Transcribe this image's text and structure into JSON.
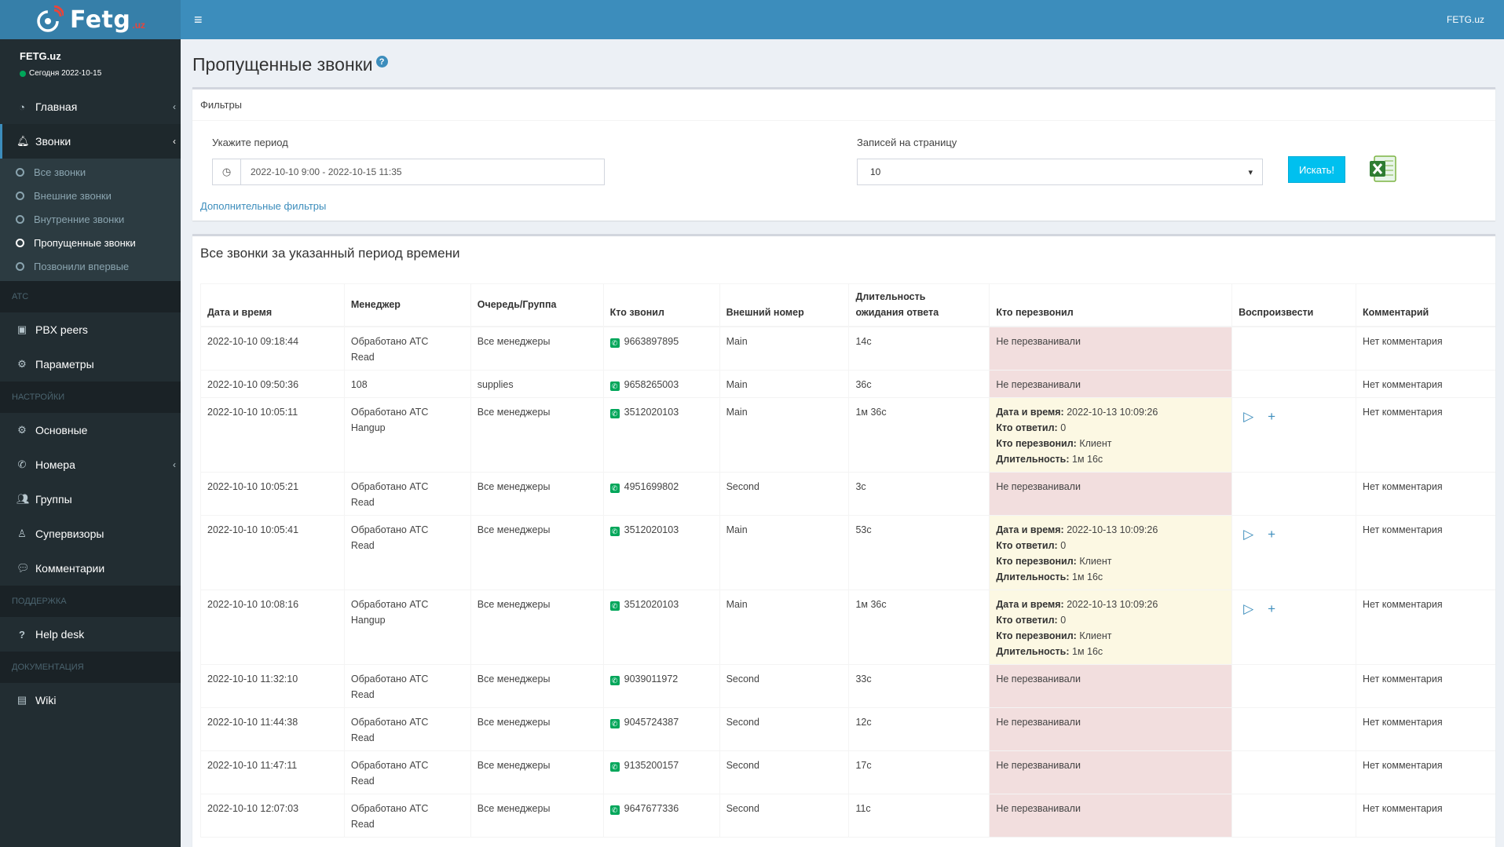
{
  "brand": {
    "name": "Fetg",
    "tld": ".uz"
  },
  "user": {
    "name": "FETG.uz",
    "status": "Сегодня 2022-10-15"
  },
  "sidebar": {
    "main": {
      "label": "Главная"
    },
    "calls": {
      "label": "Звонки"
    },
    "calls_sub": [
      {
        "label": "Все звонки"
      },
      {
        "label": "Внешние звонки"
      },
      {
        "label": "Внутренние звонки"
      },
      {
        "label": "Пропущенные звонки"
      },
      {
        "label": "Позвонили впервые"
      }
    ],
    "header_atc": "АТС",
    "pbx": {
      "label": "PBX peers"
    },
    "params": {
      "label": "Параметры"
    },
    "header_settings": "НАСТРОЙКИ",
    "basic": {
      "label": "Основные"
    },
    "numbers": {
      "label": "Номера"
    },
    "groups": {
      "label": "Группы"
    },
    "supervisors": {
      "label": "Супервизоры"
    },
    "comments": {
      "label": "Комментарии"
    },
    "header_support": "ПОДДЕРЖКА",
    "helpdesk": {
      "label": "Help desk"
    },
    "header_docs": "ДОКУМЕНТАЦИЯ",
    "wiki": {
      "label": "Wiki"
    }
  },
  "topbar": {
    "right": "FETG.uz"
  },
  "page": {
    "title": "Пропущенные звонки"
  },
  "filters": {
    "title": "Фильтры",
    "period_label": "Укажите период",
    "period_value": "2022-10-10 9:00 - 2022-10-15 11:35",
    "per_page_label": "Записей на страницу",
    "per_page_value": "10",
    "search_label": "Искать!",
    "more_filters": "Дополнительные фильтры"
  },
  "table": {
    "title": "Все звонки за указанный период времени",
    "columns": {
      "datetime": "Дата и время",
      "manager": "Менеджер",
      "queue": "Очередь/Группа",
      "caller": "Кто звонил",
      "external": "Внешний номер",
      "wait1": "Длительность",
      "wait2": "ожидания ответа",
      "callback": "Кто перезвонил",
      "play": "Воспроизвести",
      "comment": "Комментарий"
    },
    "cb_labels": {
      "datetime": "Дата и время:",
      "answered": "Кто ответил:",
      "called_back": "Кто перезвонил:",
      "duration": "Длительность:"
    },
    "no_callback": "Не перезванивали",
    "no_comment": "Нет комментария",
    "rows": [
      {
        "datetime": "2022-10-10 09:18:44",
        "manager1": "Обработано АТС",
        "manager2": "Read",
        "queue": "Все менеджеры",
        "caller": "9663897895",
        "external": "Main",
        "wait": "14с"
      },
      {
        "datetime": "2022-10-10 09:50:36",
        "manager1": "108",
        "manager2": "",
        "queue": "supplies",
        "caller": "9658265003",
        "external": "Main",
        "wait": "36с"
      },
      {
        "datetime": "2022-10-10 10:05:11",
        "manager1": "Обработано АТС",
        "manager2": "Hangup",
        "queue": "Все менеджеры",
        "caller": "3512020103",
        "external": "Main",
        "wait": "1м 36с",
        "cb": {
          "datetime": "2022-10-13 10:09:26",
          "answered": "0",
          "called_back": "Клиент",
          "duration": "1м 16с"
        }
      },
      {
        "datetime": "2022-10-10 10:05:21",
        "manager1": "Обработано АТС",
        "manager2": "Read",
        "queue": "Все менеджеры",
        "caller": "4951699802",
        "external": "Second",
        "wait": "3с"
      },
      {
        "datetime": "2022-10-10 10:05:41",
        "manager1": "Обработано АТС",
        "manager2": "Read",
        "queue": "Все менеджеры",
        "caller": "3512020103",
        "external": "Main",
        "wait": "53с",
        "cb": {
          "datetime": "2022-10-13 10:09:26",
          "answered": "0",
          "called_back": "Клиент",
          "duration": "1м 16с"
        }
      },
      {
        "datetime": "2022-10-10 10:08:16",
        "manager1": "Обработано АТС",
        "manager2": "Hangup",
        "queue": "Все менеджеры",
        "caller": "3512020103",
        "external": "Main",
        "wait": "1м 36с",
        "cb": {
          "datetime": "2022-10-13 10:09:26",
          "answered": "0",
          "called_back": "Клиент",
          "duration": "1м 16с"
        }
      },
      {
        "datetime": "2022-10-10 11:32:10",
        "manager1": "Обработано АТС",
        "manager2": "Read",
        "queue": "Все менеджеры",
        "caller": "9039011972",
        "external": "Second",
        "wait": "33с"
      },
      {
        "datetime": "2022-10-10 11:44:38",
        "manager1": "Обработано АТС",
        "manager2": "Read",
        "queue": "Все менеджеры",
        "caller": "9045724387",
        "external": "Second",
        "wait": "12с"
      },
      {
        "datetime": "2022-10-10 11:47:11",
        "manager1": "Обработано АТС",
        "manager2": "Read",
        "queue": "Все менеджеры",
        "caller": "9135200157",
        "external": "Second",
        "wait": "17с"
      },
      {
        "datetime": "2022-10-10 12:07:03",
        "manager1": "Обработано АТС",
        "manager2": "Read",
        "queue": "Все менеджеры",
        "caller": "9647677336",
        "external": "Second",
        "wait": "11с"
      }
    ]
  },
  "colors": {
    "topbar": "#3c8dbc",
    "sidebar": "#222d32",
    "no_callback_bg": "#f2dede",
    "callback_bg": "#fcf8e3",
    "search_btn": "#00c0ef"
  }
}
